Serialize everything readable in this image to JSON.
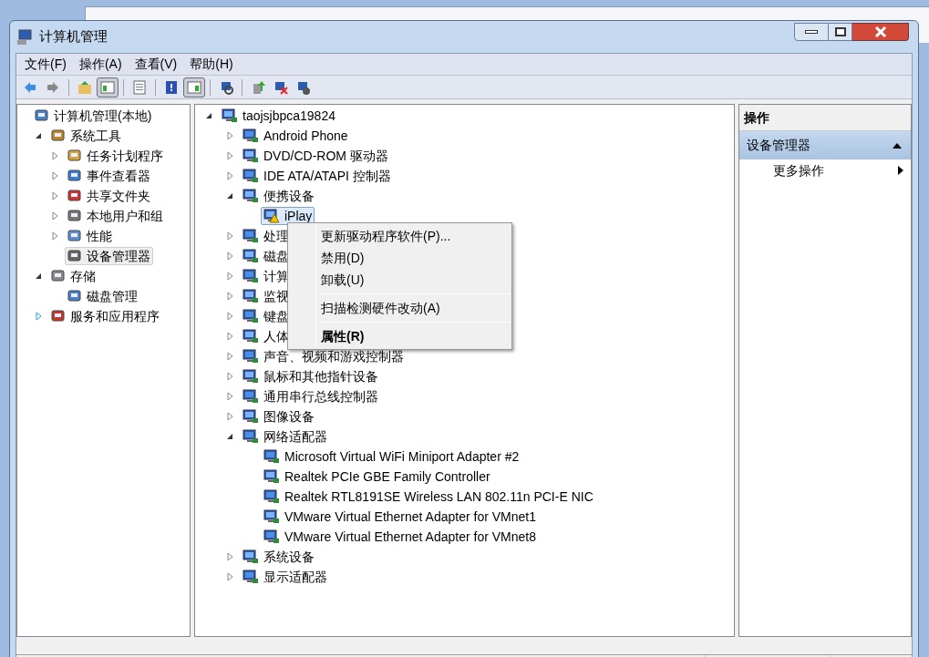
{
  "window": {
    "title": "计算机管理"
  },
  "menu": [
    {
      "label": "文件(F)"
    },
    {
      "label": "操作(A)"
    },
    {
      "label": "查看(V)"
    },
    {
      "label": "帮助(H)"
    }
  ],
  "toolbar": [
    {
      "kind": "button",
      "selected": false
    },
    {
      "kind": "button",
      "selected": false
    },
    {
      "kind": "separator"
    },
    {
      "kind": "button",
      "selected": false
    },
    {
      "kind": "button",
      "selected": true
    },
    {
      "kind": "separator"
    },
    {
      "kind": "button",
      "selected": false
    },
    {
      "kind": "separator"
    },
    {
      "kind": "button",
      "selected": false
    },
    {
      "kind": "button",
      "selected": true
    },
    {
      "kind": "separator"
    },
    {
      "kind": "button",
      "selected": false
    },
    {
      "kind": "separator"
    },
    {
      "kind": "button",
      "selected": false
    },
    {
      "kind": "button",
      "selected": false
    },
    {
      "kind": "button",
      "selected": false
    }
  ],
  "nav_tree": [
    {
      "label": "计算机管理(本地)",
      "selected": false,
      "children": [
        {
          "label": "系统工具",
          "expanded": true,
          "selected": false,
          "children": [
            {
              "label": "任务计划程序",
              "expanded": false,
              "selected": false
            },
            {
              "label": "事件查看器",
              "expanded": false,
              "selected": false
            },
            {
              "label": "共享文件夹",
              "expanded": false,
              "selected": false
            },
            {
              "label": "本地用户和组",
              "expanded": false,
              "selected": false
            },
            {
              "label": "性能",
              "expanded": false,
              "selected": false
            },
            {
              "label": "设备管理器",
              "selected": true
            }
          ]
        },
        {
          "label": "存储",
          "expanded": true,
          "selected": false,
          "children": [
            {
              "label": "磁盘管理",
              "selected": false
            }
          ]
        },
        {
          "label": "服务和应用程序",
          "expanded": false,
          "selected": false
        }
      ]
    }
  ],
  "device_tree": [
    {
      "label": "taojsjbpca19824",
      "expanded": true,
      "selected": false,
      "children": [
        {
          "label": "Android Phone",
          "expanded": false,
          "selected": false
        },
        {
          "label": "DVD/CD-ROM 驱动器",
          "expanded": false,
          "selected": false
        },
        {
          "label": "IDE ATA/ATAPI 控制器",
          "expanded": false,
          "selected": false
        },
        {
          "label": "便携设备",
          "expanded": true,
          "selected": false,
          "children": [
            {
              "label": "iPlay",
              "selected": true,
              "warning": true
            }
          ]
        },
        {
          "label": "处理",
          "expanded": false,
          "selected": false
        },
        {
          "label": "磁盘",
          "expanded": false,
          "selected": false
        },
        {
          "label": "计算",
          "expanded": false,
          "selected": false
        },
        {
          "label": "监视",
          "expanded": false,
          "selected": false
        },
        {
          "label": "键盘",
          "expanded": false,
          "selected": false
        },
        {
          "label": "人体",
          "expanded": false,
          "selected": false
        },
        {
          "label": "声音、视频和游戏控制器",
          "expanded": false,
          "selected": false
        },
        {
          "label": "鼠标和其他指针设备",
          "expanded": false,
          "selected": false
        },
        {
          "label": "通用串行总线控制器",
          "expanded": false,
          "selected": false
        },
        {
          "label": "图像设备",
          "expanded": false,
          "selected": false
        },
        {
          "label": "网络适配器",
          "expanded": true,
          "selected": false,
          "children": [
            {
              "label": "Microsoft Virtual WiFi Miniport Adapter #2",
              "selected": false
            },
            {
              "label": "Realtek PCIe GBE Family Controller",
              "selected": false
            },
            {
              "label": "Realtek RTL8191SE Wireless LAN 802.11n PCI-E NIC",
              "selected": false
            },
            {
              "label": "VMware Virtual Ethernet Adapter for VMnet1",
              "selected": false
            },
            {
              "label": "VMware Virtual Ethernet Adapter for VMnet8",
              "selected": false
            }
          ]
        },
        {
          "label": "系统设备",
          "expanded": false,
          "selected": false
        },
        {
          "label": "显示适配器",
          "expanded": false,
          "selected": false
        }
      ]
    }
  ],
  "context_menu": [
    {
      "kind": "item",
      "label": "更新驱动程序软件(P)...",
      "default": false
    },
    {
      "kind": "item",
      "label": "禁用(D)",
      "default": false
    },
    {
      "kind": "item",
      "label": "卸载(U)",
      "default": false
    },
    {
      "kind": "separator"
    },
    {
      "kind": "item",
      "label": "扫描检测硬件改动(A)",
      "default": false
    },
    {
      "kind": "separator"
    },
    {
      "kind": "item",
      "label": "属性(R)",
      "default": true
    }
  ],
  "actions": {
    "header": "操作",
    "sections": [
      {
        "title": "设备管理器",
        "expanded": true,
        "items": [
          {
            "label": "更多操作"
          }
        ]
      }
    ]
  }
}
